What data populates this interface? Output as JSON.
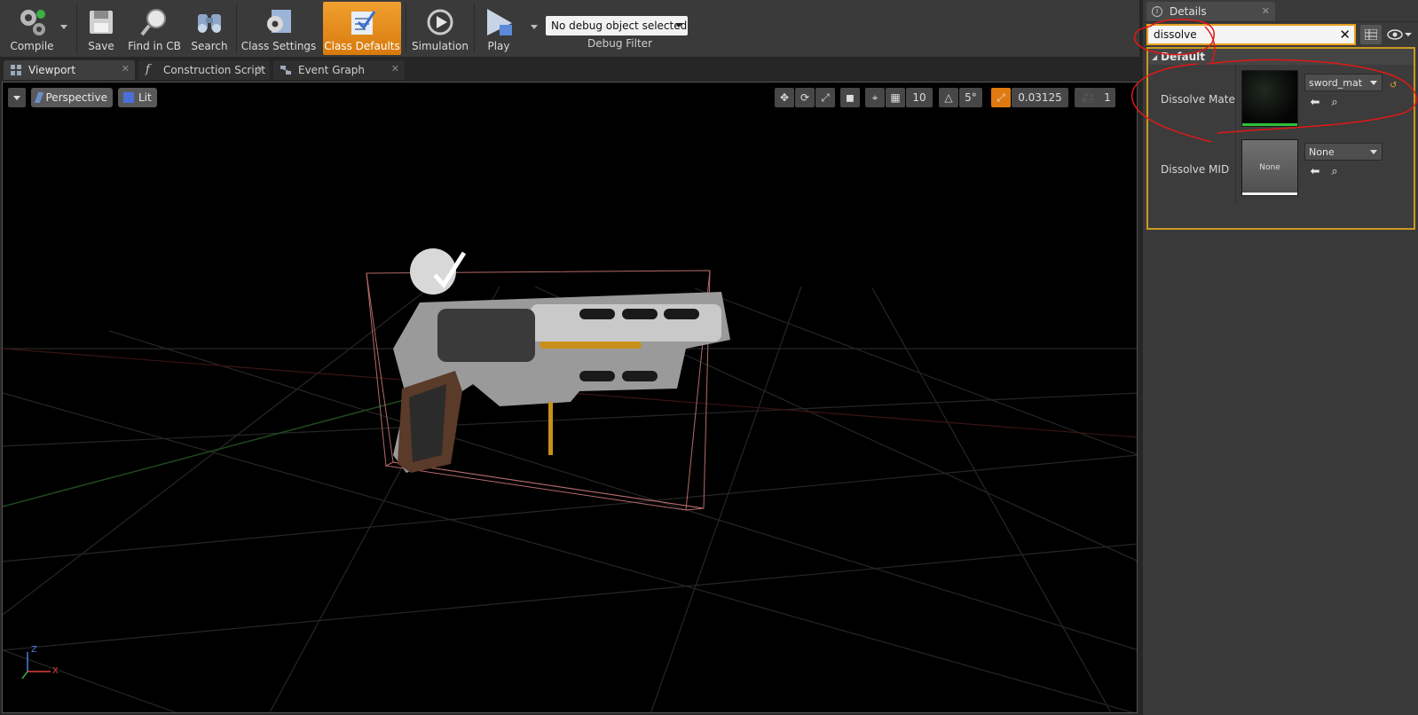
{
  "toolbar": {
    "compile_label": "Compile",
    "save_label": "Save",
    "find_in_cb_label": "Find in CB",
    "search_label": "Search",
    "class_settings_label": "Class Settings",
    "class_defaults_label": "Class Defaults",
    "simulation_label": "Simulation",
    "play_label": "Play",
    "debug_object_value": "No debug object selected",
    "debug_filter_label": "Debug Filter"
  },
  "tabs": [
    {
      "label": "Viewport",
      "icon": "viewport-icon"
    },
    {
      "label": "Construction Script",
      "icon": "function-icon"
    },
    {
      "label": "Event Graph",
      "icon": "graph-icon"
    }
  ],
  "viewport": {
    "view_mode": "Perspective",
    "lighting_mode": "Lit",
    "grid_snap_value": "10",
    "rotation_snap_value": "5°",
    "scale_snap_value": "0.03125",
    "camera_speed_value": "1",
    "axis_labels": {
      "z": "Z",
      "x": "X"
    }
  },
  "details": {
    "tab_label": "Details",
    "search_value": "dissolve",
    "category_label": "Default",
    "properties": [
      {
        "name": "Dissolve Material",
        "asset": "sword_mat",
        "thumb_label": ""
      },
      {
        "name": "Dissolve MID",
        "asset": "None",
        "thumb_label": "None"
      }
    ]
  },
  "colors": {
    "accent_orange": "#e8a020",
    "annotation_red": "#e01818",
    "material_bar_green": "#2fbf3a"
  }
}
